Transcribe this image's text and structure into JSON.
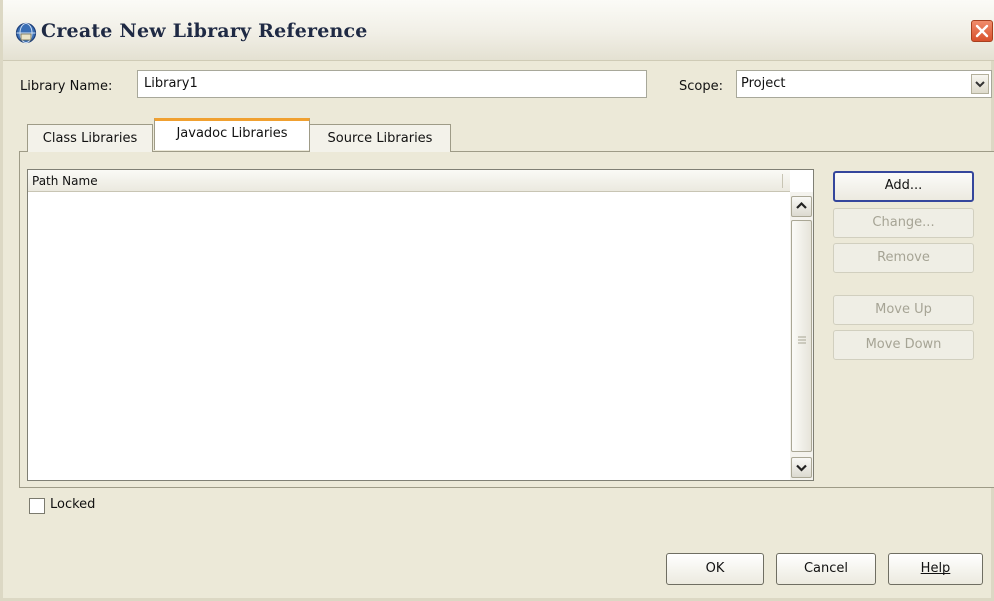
{
  "window": {
    "title": "Create New Library Reference",
    "title_icon": "library-globe-icon",
    "close_icon": "close-icon"
  },
  "form": {
    "library_name_label": "Library Name:",
    "library_name_value": "Library1",
    "scope_label": "Scope:",
    "scope_value": "Project"
  },
  "tabs": [
    {
      "label": "Class Libraries",
      "active": false
    },
    {
      "label": "Javadoc Libraries",
      "active": true
    },
    {
      "label": "Source Libraries",
      "active": false
    }
  ],
  "list": {
    "column_header": "Path Name",
    "rows": []
  },
  "side_buttons": {
    "add": "Add...",
    "change": "Change...",
    "remove": "Remove",
    "move_up": "Move Up",
    "move_down": "Move Down"
  },
  "locked_label": "Locked",
  "locked_checked": false,
  "footer": {
    "ok": "OK",
    "cancel": "Cancel",
    "help": "Help"
  },
  "colors": {
    "active_tab_accent": "#f0a030",
    "default_button_border": "#34469c",
    "close_button": "#d8502c"
  }
}
